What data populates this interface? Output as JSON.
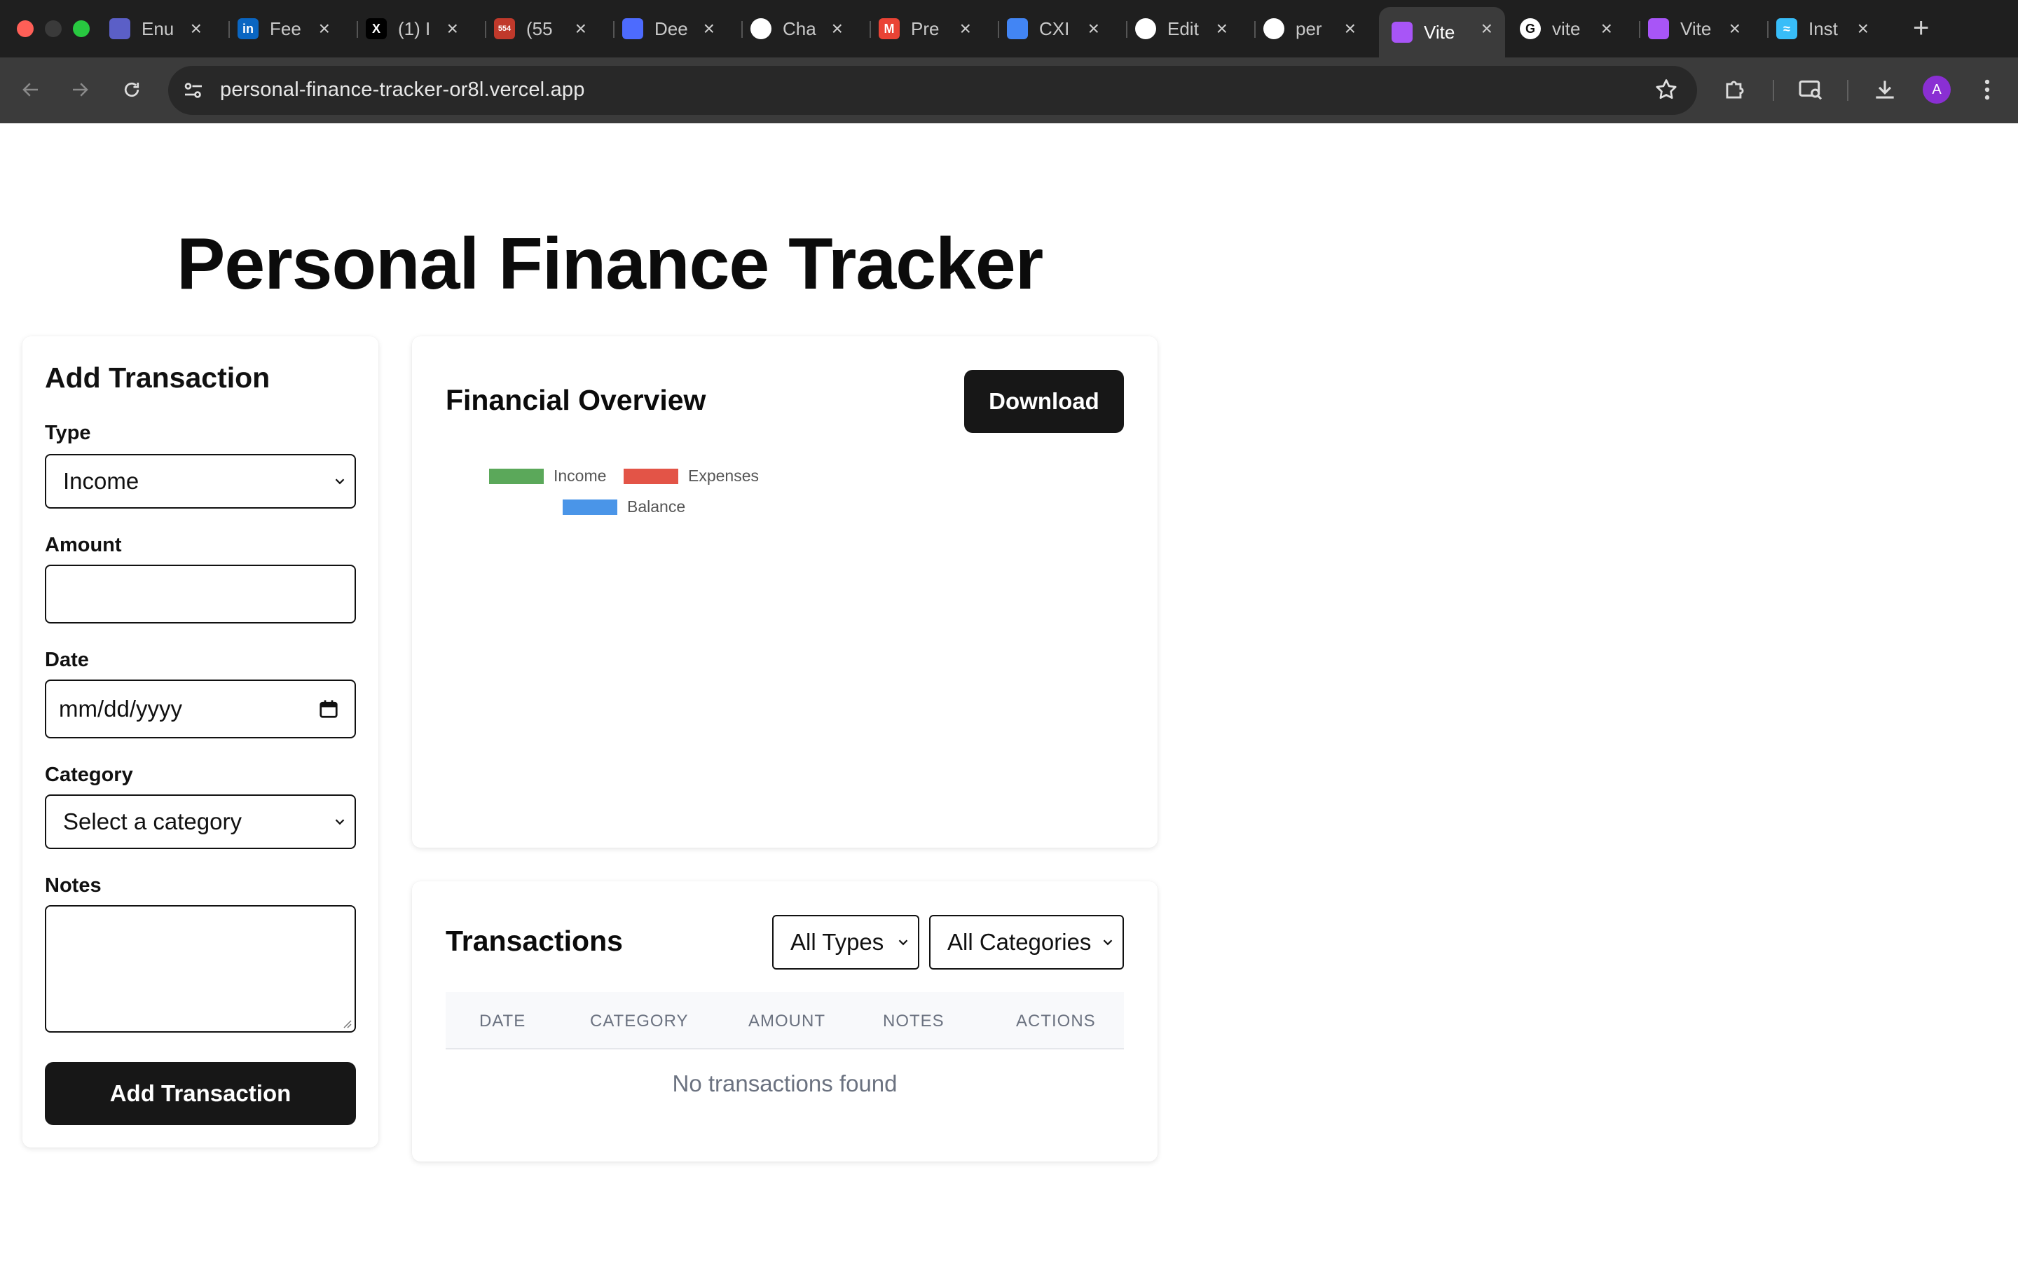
{
  "browser": {
    "tabs": [
      {
        "title": "Enu",
        "icon": "teams-icon",
        "color": "#5b5fc7",
        "glyph": ""
      },
      {
        "title": "Fee",
        "icon": "linkedin-icon",
        "color": "#0a66c2",
        "glyph": "in"
      },
      {
        "title": "(1) I",
        "icon": "x-icon",
        "color": "#000000",
        "glyph": "X"
      },
      {
        "title": "(55",
        "icon": "mail-badge-icon",
        "color": "#c0392b",
        "glyph": "554"
      },
      {
        "title": "Dee",
        "icon": "deepseek-icon",
        "color": "#4d6bfe",
        "glyph": ""
      },
      {
        "title": "Cha",
        "icon": "chatgpt-icon",
        "color": "#ffffff",
        "glyph": ""
      },
      {
        "title": "Pre",
        "icon": "gmail-icon",
        "color": "#ea4335",
        "glyph": "M"
      },
      {
        "title": "CXI",
        "icon": "docs-icon",
        "color": "#4285f4",
        "glyph": ""
      },
      {
        "title": "Edit",
        "icon": "github-icon",
        "color": "#ffffff",
        "glyph": ""
      },
      {
        "title": "per",
        "icon": "vercel-icon",
        "color": "#ffffff",
        "glyph": ""
      },
      {
        "title": "Vite",
        "icon": "vite-icon",
        "color": "#a855f7",
        "glyph": "",
        "active": true
      },
      {
        "title": "vite",
        "icon": "google-icon",
        "color": "#ffffff",
        "glyph": "G"
      },
      {
        "title": "Vite",
        "icon": "vite-icon",
        "color": "#a855f7",
        "glyph": ""
      },
      {
        "title": "Inst",
        "icon": "tailwind-icon",
        "color": "#38bdf8",
        "glyph": "≈"
      }
    ],
    "url": "personal-finance-tracker-or8l.vercel.app",
    "profile_initial": "A"
  },
  "page": {
    "title": "Personal Finance Tracker"
  },
  "form": {
    "heading": "Add Transaction",
    "type_label": "Type",
    "type_value": "Income",
    "amount_label": "Amount",
    "amount_value": "",
    "date_label": "Date",
    "date_placeholder": "mm/dd/yyyy",
    "category_label": "Category",
    "category_value": "Select a category",
    "notes_label": "Notes",
    "notes_value": "",
    "submit_label": "Add Transaction"
  },
  "overview": {
    "title": "Financial Overview",
    "download_label": "Download",
    "chart_data": {
      "type": "bar",
      "categories": [],
      "series": [
        {
          "name": "Income",
          "color": "#5ba85a",
          "values": []
        },
        {
          "name": "Expenses",
          "color": "#e35447",
          "values": []
        },
        {
          "name": "Balance",
          "color": "#4a95e8",
          "values": []
        }
      ],
      "legend_position": "top-left"
    }
  },
  "transactions": {
    "title": "Transactions",
    "type_filter": "All Types",
    "category_filter": "All Categories",
    "columns": [
      "DATE",
      "CATEGORY",
      "AMOUNT",
      "NOTES",
      "ACTIONS"
    ],
    "empty_message": "No transactions found"
  }
}
